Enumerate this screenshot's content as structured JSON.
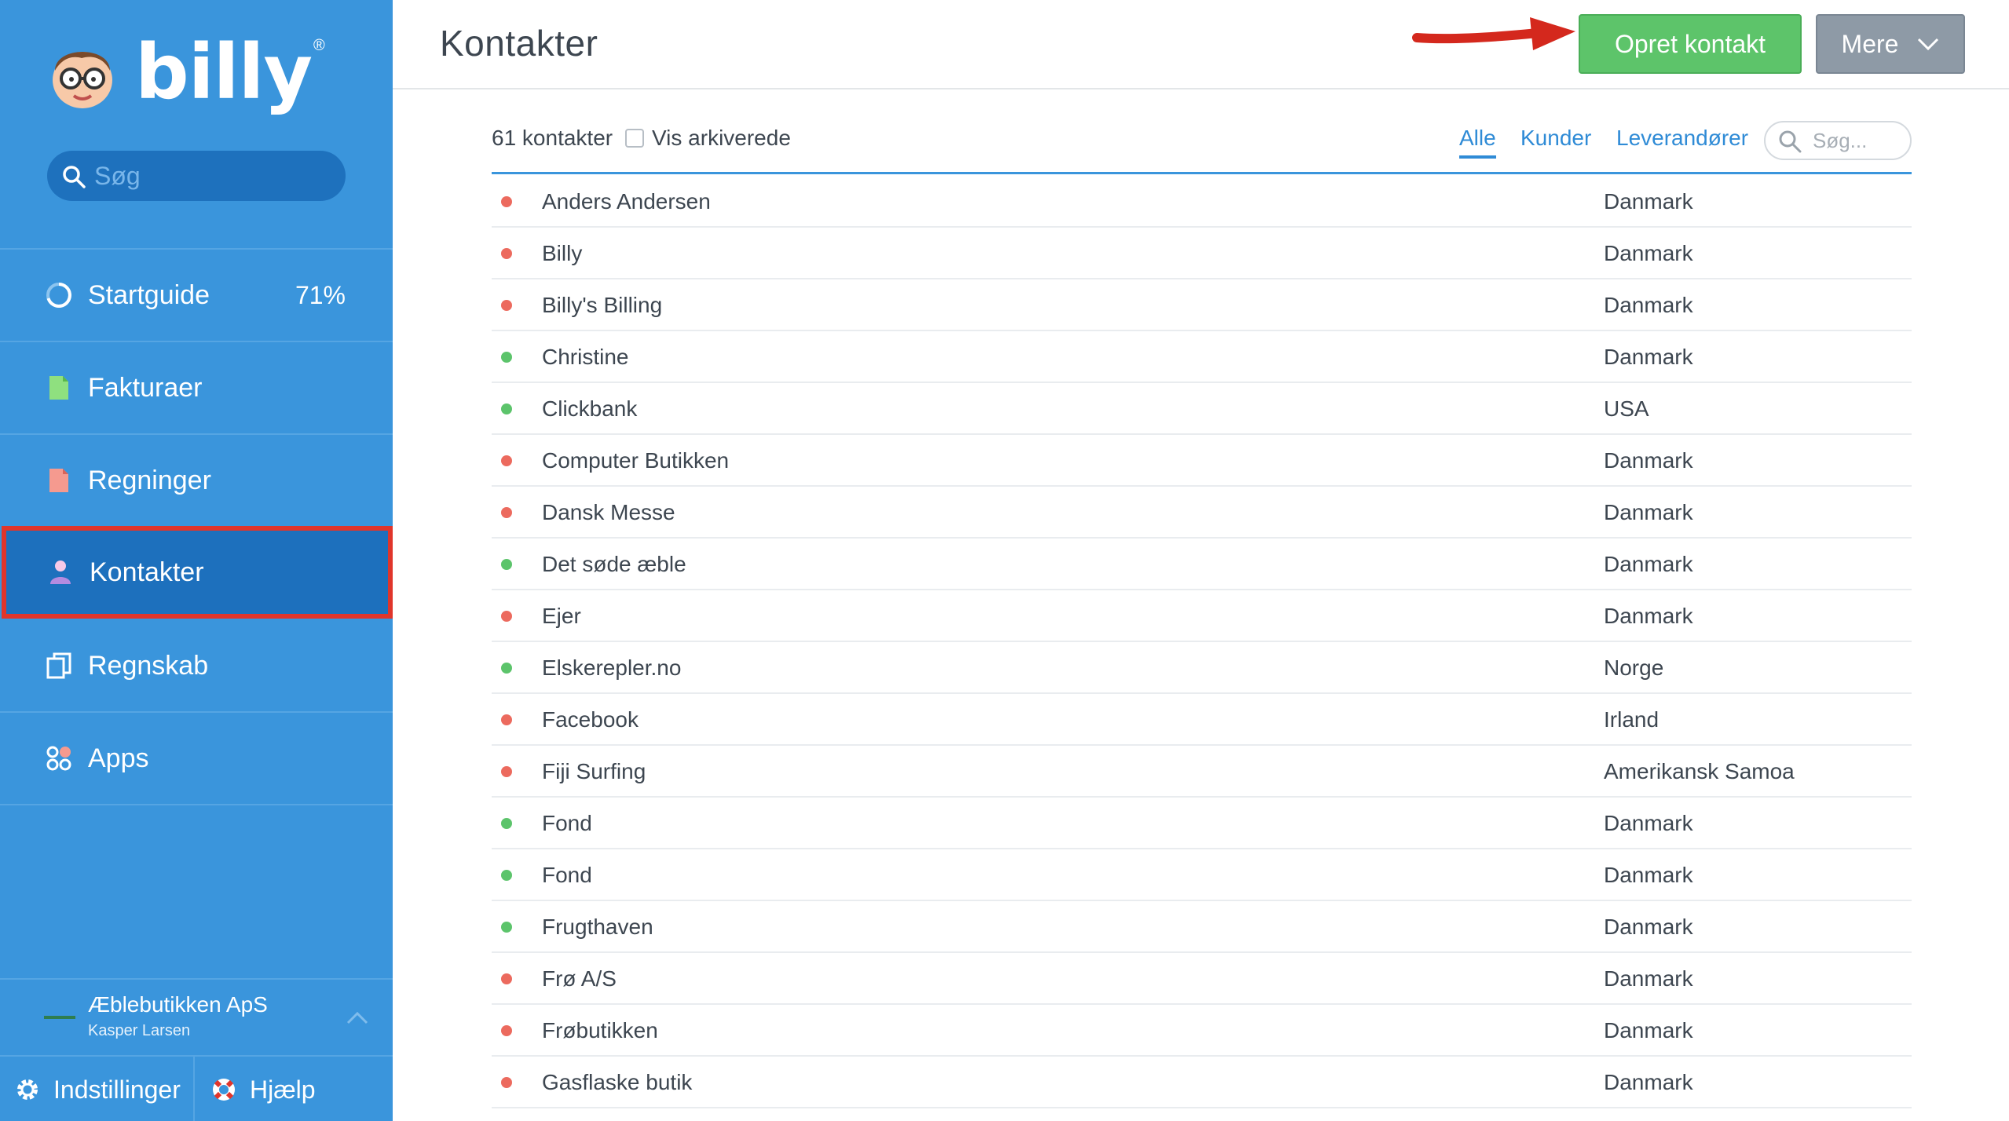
{
  "app": {
    "logo_text": "billy",
    "logo_mark": "®"
  },
  "sidebar": {
    "search_placeholder": "Søg",
    "items": [
      {
        "label": "Startguide",
        "icon": "progress-ring-icon",
        "badge": "71%"
      },
      {
        "label": "Fakturaer",
        "icon": "invoice-icon"
      },
      {
        "label": "Regninger",
        "icon": "bill-icon"
      },
      {
        "label": "Kontakter",
        "icon": "person-icon",
        "active": true
      },
      {
        "label": "Regnskab",
        "icon": "books-icon"
      },
      {
        "label": "Apps",
        "icon": "apps-icon"
      }
    ],
    "company": {
      "name": "Æblebutikken ApS",
      "user": "Kasper Larsen"
    },
    "bottom": {
      "settings_label": "Indstillinger",
      "help_label": "Hjælp"
    }
  },
  "header": {
    "title": "Kontakter",
    "create_button": "Opret kontakt",
    "more_button": "Mere"
  },
  "toolbar": {
    "count_text": "61 kontakter",
    "archived_label": "Vis arkiverede",
    "archived_checked": false,
    "filters": [
      "Alle",
      "Kunder",
      "Leverandører"
    ],
    "active_filter": "Alle",
    "search_placeholder": "Søg..."
  },
  "colors": {
    "sidebar_bg": "#3a95dc",
    "sidebar_active": "#1d70bd",
    "highlight_red": "#e0352b",
    "create_green": "#5dc46a",
    "more_gray": "#8e9aa6",
    "status_red": "#ec6a5e",
    "status_green": "#5cc46b"
  },
  "contacts": [
    {
      "name": "Anders Andersen",
      "country": "Danmark",
      "status": "red"
    },
    {
      "name": "Billy",
      "country": "Danmark",
      "status": "red"
    },
    {
      "name": "Billy's Billing",
      "country": "Danmark",
      "status": "red"
    },
    {
      "name": "Christine",
      "country": "Danmark",
      "status": "green"
    },
    {
      "name": "Clickbank",
      "country": "USA",
      "status": "green"
    },
    {
      "name": "Computer Butikken",
      "country": "Danmark",
      "status": "red"
    },
    {
      "name": "Dansk Messe",
      "country": "Danmark",
      "status": "red"
    },
    {
      "name": "Det søde æble",
      "country": "Danmark",
      "status": "green"
    },
    {
      "name": "Ejer",
      "country": "Danmark",
      "status": "red"
    },
    {
      "name": "Elskerepler.no",
      "country": "Norge",
      "status": "green"
    },
    {
      "name": "Facebook",
      "country": "Irland",
      "status": "red"
    },
    {
      "name": "Fiji Surfing",
      "country": "Amerikansk Samoa",
      "status": "red"
    },
    {
      "name": "Fond",
      "country": "Danmark",
      "status": "green"
    },
    {
      "name": "Fond",
      "country": "Danmark",
      "status": "green"
    },
    {
      "name": "Frugthaven",
      "country": "Danmark",
      "status": "green"
    },
    {
      "name": "Frø A/S",
      "country": "Danmark",
      "status": "red"
    },
    {
      "name": "Frøbutikken",
      "country": "Danmark",
      "status": "red"
    },
    {
      "name": "Gasflaske butik",
      "country": "Danmark",
      "status": "red"
    }
  ]
}
